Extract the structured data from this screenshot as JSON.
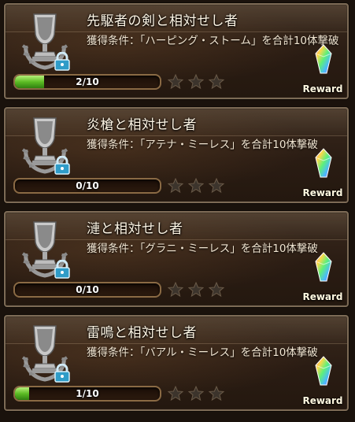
{
  "achievements": [
    {
      "title": "先駆者の剣と相対せし者",
      "condition": "獲得条件：「ハーピング・ストーム」を合計10体撃破",
      "progress_text": "2/10",
      "progress_fraction": 0.2,
      "stars": 3,
      "reward_label": "Reward"
    },
    {
      "title": "炎槍と相対せし者",
      "condition": "獲得条件：「アテナ・ミーレス」を合計10体撃破",
      "progress_text": "0/10",
      "progress_fraction": 0.0,
      "stars": 3,
      "reward_label": "Reward"
    },
    {
      "title": "漣と相対せし者",
      "condition": "獲得条件：「グラニ・ミーレス」を合計10体撃破",
      "progress_text": "0/10",
      "progress_fraction": 0.0,
      "stars": 3,
      "reward_label": "Reward"
    },
    {
      "title": "雷鳴と相対せし者",
      "condition": "獲得条件：「バアル・ミーレス」を合計10体撃破",
      "progress_text": "1/10",
      "progress_fraction": 0.1,
      "stars": 3,
      "reward_label": "Reward"
    }
  ],
  "icons": {
    "trophy": "silver-trophy-icon",
    "lock": "lock-icon",
    "star": "star-icon",
    "reward": "rainbow-crystal-icon"
  },
  "colors": {
    "progress_fill": "#5cbc24",
    "star": "#3c342c",
    "lock": "#3aa6d0"
  }
}
